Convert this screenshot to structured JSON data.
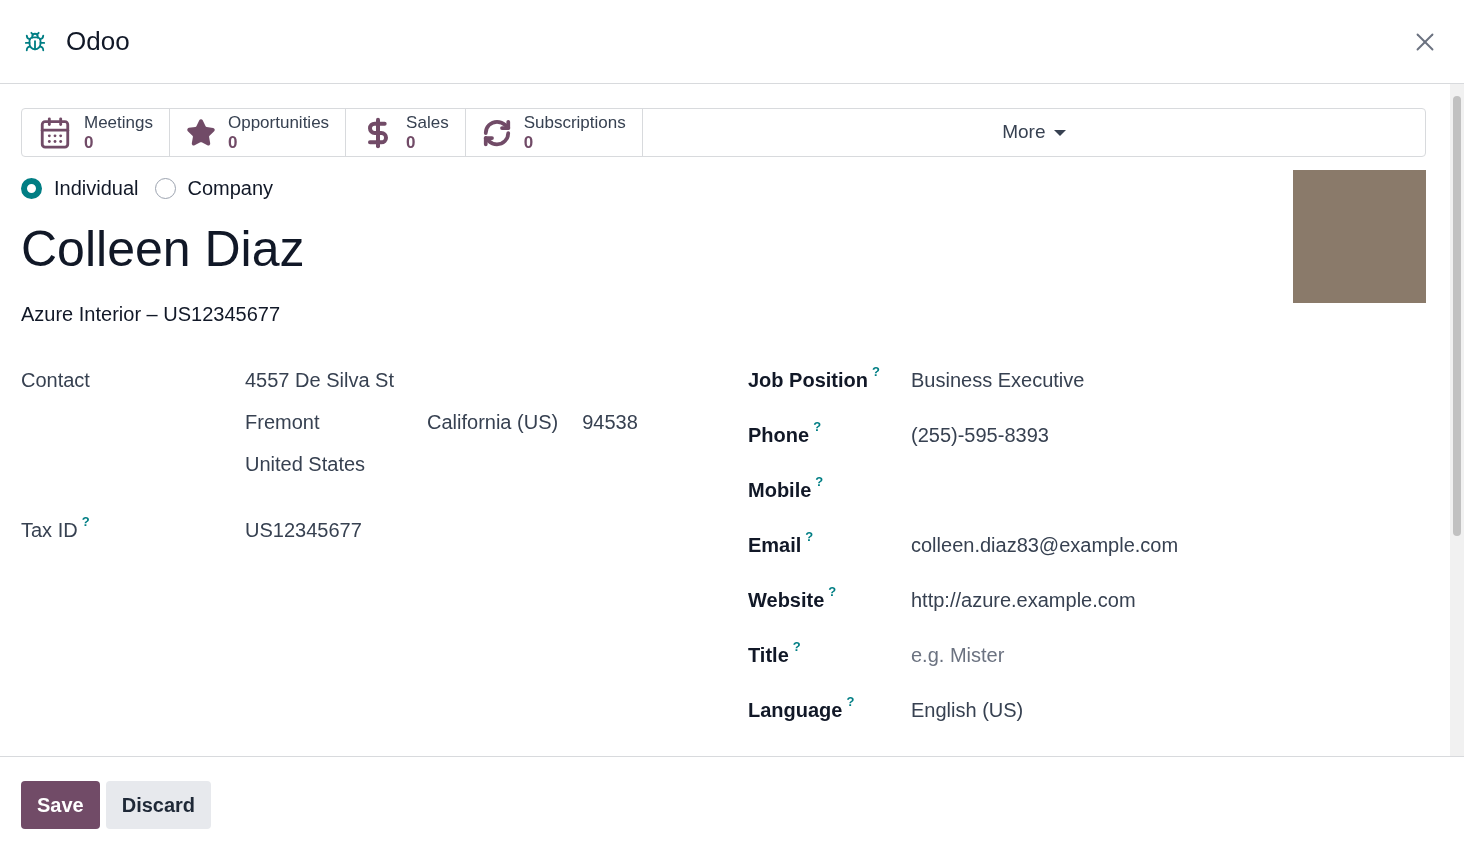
{
  "window": {
    "title": "Odoo"
  },
  "stat_buttons": [
    {
      "kind": "calendar",
      "label": "Meetings",
      "count": "0"
    },
    {
      "kind": "star",
      "label": "Opportunities",
      "count": "0"
    },
    {
      "kind": "dollar",
      "label": "Sales",
      "count": "0"
    },
    {
      "kind": "refresh",
      "label": "Subscriptions",
      "count": "0"
    }
  ],
  "more_button": {
    "label": "More"
  },
  "company_type": [
    {
      "label": "Individual",
      "selected": true
    },
    {
      "label": "Company",
      "selected": false
    }
  ],
  "name": "Colleen Diaz",
  "parent_company": "Azure Interior – US12345677",
  "left_fields": [
    {
      "kind": "address",
      "label": "Contact",
      "street": "4557 De Silva St",
      "city": "Fremont",
      "state": "California (US)",
      "zip": "94538",
      "country": "United States"
    },
    {
      "kind": "text",
      "label": "Tax ID",
      "help": "?",
      "value": "US12345677"
    }
  ],
  "right_fields": [
    {
      "label": "Job Position",
      "help": "?",
      "value": "Business Executive"
    },
    {
      "label": "Phone",
      "help": "?",
      "value": "(255)-595-8393"
    },
    {
      "label": "Mobile",
      "help": "?"
    },
    {
      "label": "Email",
      "help": "?",
      "value": "colleen.diaz83@example.com"
    },
    {
      "label": "Website",
      "help": "?",
      "value": "http://azure.example.com"
    },
    {
      "label": "Title",
      "help": "?",
      "placeholder": "e.g. Mister"
    },
    {
      "label": "Language",
      "help": "?",
      "value": "English (US)"
    }
  ],
  "footer_buttons": [
    {
      "kind": "primary",
      "label": "Save"
    },
    {
      "kind": "secondary",
      "label": "Discard"
    }
  ]
}
